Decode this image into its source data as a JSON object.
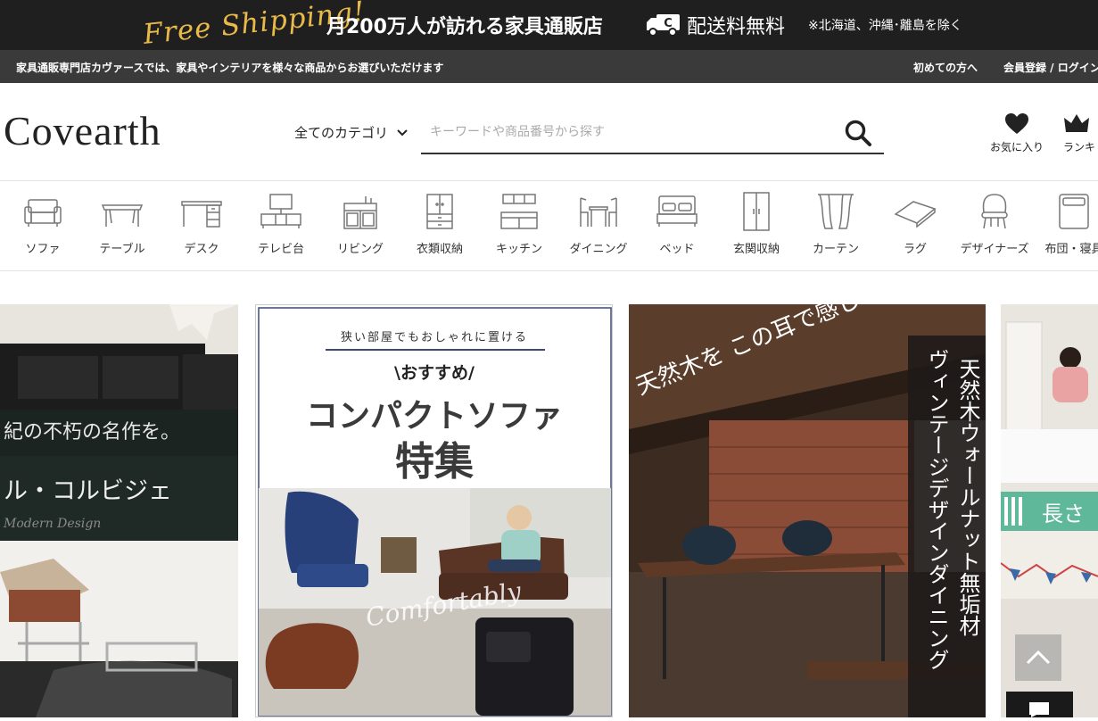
{
  "banner": {
    "free_shipping": "Free Shipping!",
    "headline": "月200万人が訪れる家具通販店",
    "free_label": "配送料無料",
    "note": "※北海道、沖縄･離島を除く"
  },
  "info_bar": {
    "text": "家具通販専門店カヴァースでは、家具やインテリアを様々な商品からお選びいただけます",
    "first_time_link": "初めての方へ",
    "register_link": "会員登録 / ログイン"
  },
  "header": {
    "logo": "Covearth",
    "category_select": "全てのカテゴリ",
    "search_placeholder": "キーワードや商品番号から探す",
    "favorites_label": "お気に入り",
    "ranking_label": "ランキ"
  },
  "categories": [
    {
      "label": "ソファ",
      "icon": "sofa-icon"
    },
    {
      "label": "テーブル",
      "icon": "table-icon"
    },
    {
      "label": "デスク",
      "icon": "desk-icon"
    },
    {
      "label": "テレビ台",
      "icon": "tv-stand-icon"
    },
    {
      "label": "リビング",
      "icon": "living-cabinet-icon"
    },
    {
      "label": "衣類収納",
      "icon": "wardrobe-icon"
    },
    {
      "label": "キッチン",
      "icon": "kitchen-icon"
    },
    {
      "label": "ダイニング",
      "icon": "dining-icon"
    },
    {
      "label": "ベッド",
      "icon": "bed-icon"
    },
    {
      "label": "玄関収納",
      "icon": "entrance-storage-icon"
    },
    {
      "label": "カーテン",
      "icon": "curtain-icon"
    },
    {
      "label": "ラグ",
      "icon": "rug-icon"
    },
    {
      "label": "デザイナーズ",
      "icon": "designer-chair-icon"
    },
    {
      "label": "布団・寝具",
      "icon": "bedding-icon"
    }
  ],
  "promos": {
    "corbusier": {
      "tagline": "紀の不朽の名作を。",
      "title": "ル・コルビジェ",
      "script": "Modern Design"
    },
    "compact_sofa": {
      "top_line": "狭い部屋でもおしゃれに置ける",
      "recommend": "\\おすすめ/",
      "title": "コンパクトソファ",
      "subtitle": "特集",
      "script": "Comfortably"
    },
    "walnut": {
      "handwritten": "天然木を この耳で感じる。",
      "vertical_title": "天然木ウォールナット無垢材",
      "vertical_sub": "ヴィンテージデザインダイニング"
    },
    "bed": {
      "title": "長さ"
    }
  },
  "colors": {
    "banner_bg": "#1f1f1f",
    "info_bar_bg": "#3a3a3a",
    "gold": "#e9b949"
  }
}
